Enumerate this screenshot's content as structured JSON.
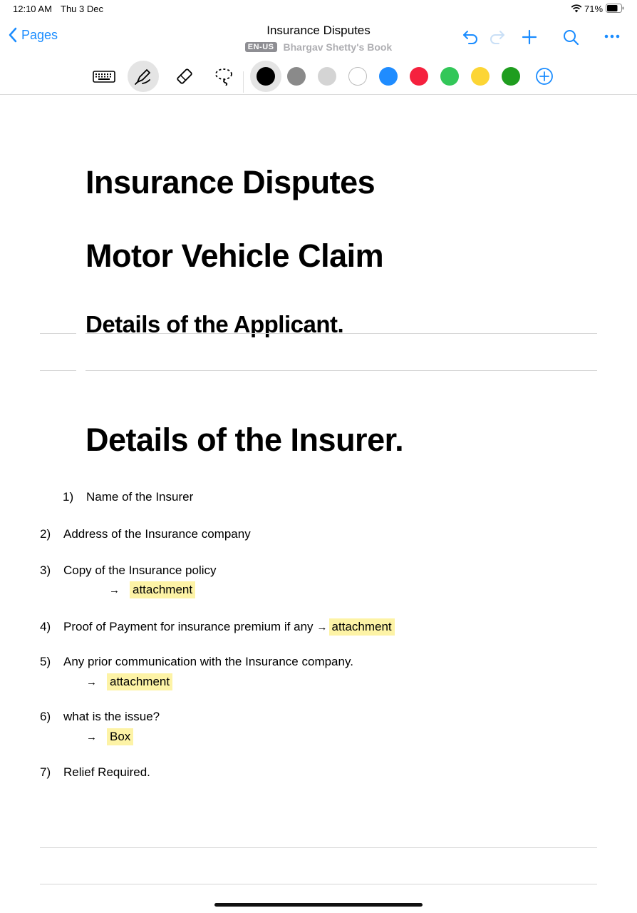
{
  "status": {
    "time": "12:10 AM",
    "date": "Thu 3 Dec",
    "battery": "71%"
  },
  "nav": {
    "back_label": "Pages",
    "title": "Insurance Disputes",
    "language": "EN-US",
    "book": "Bhargav Shetty's Book"
  },
  "toolbar": {
    "tools": [
      "keyboard-icon",
      "pen-icon",
      "eraser-icon",
      "lasso-icon"
    ],
    "colors": [
      "#000000",
      "#8a8a8a",
      "#d4d4d4",
      "#ffffff",
      "#1f8cff",
      "#f5213e",
      "#33c759",
      "#fcd535",
      "#1f9d1f"
    ]
  },
  "doc": {
    "h1": "Insurance Disputes",
    "h2": "Motor Vehicle Claim",
    "h3": "Details of the Applicant.",
    "h4": "Details of the Insurer.",
    "items": [
      {
        "num": "1)",
        "text": "Name of the Insurer"
      },
      {
        "num": "2)",
        "text": "Address of the Insurance company"
      },
      {
        "num": "3)",
        "text": "Copy of the Insurance policy",
        "arrow": "→",
        "tag": "attachment"
      },
      {
        "num": "4)",
        "text": "Proof of Payment for insurance premium if any",
        "arrow": "→",
        "tag": "attachment"
      },
      {
        "num": "5)",
        "text": "Any prior communication with the Insurance company.",
        "arrow": "→",
        "tag": "attachment"
      },
      {
        "num": "6)",
        "text": "what is the issue?",
        "arrow": "→",
        "tag": "Box"
      },
      {
        "num": "7)",
        "text": "Relief Required."
      }
    ]
  }
}
